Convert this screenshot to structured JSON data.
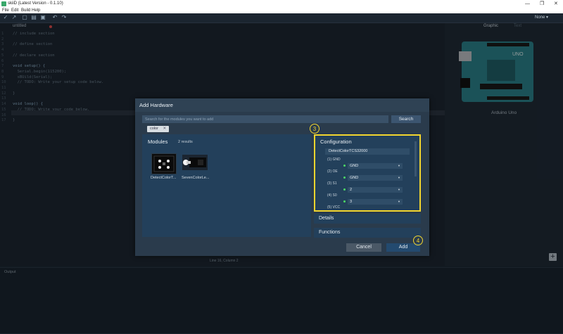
{
  "window": {
    "title": "skiiD (Latest Version - 0.1.10)",
    "minimize": "—",
    "maximize": "❐",
    "close": "✕"
  },
  "menu": {
    "file": "File",
    "edit": "Edit",
    "build": "Build",
    "help": "Help"
  },
  "toolbar": {
    "board_selector": "None ▾"
  },
  "editor": {
    "tab_name": "untitled",
    "lines": [
      {
        "n": "1",
        "text": "// include section"
      },
      {
        "n": "2",
        "text": ""
      },
      {
        "n": "3",
        "text": "// define section"
      },
      {
        "n": "4",
        "text": ""
      },
      {
        "n": "5",
        "text": "// declare section"
      },
      {
        "n": "6",
        "text": ""
      },
      {
        "n": "7",
        "text": "void setup() {"
      },
      {
        "n": "8",
        "text": "  Serial.begin(115200);"
      },
      {
        "n": "9",
        "text": "  sBUild(Serial);"
      },
      {
        "n": "10",
        "text": "  // TODO: Write your setup code below."
      },
      {
        "n": "11",
        "text": ""
      },
      {
        "n": "12",
        "text": "}"
      },
      {
        "n": "13",
        "text": ""
      },
      {
        "n": "14",
        "text": "void loop() {"
      },
      {
        "n": "15",
        "text": "  // TODO: Write your code below."
      },
      {
        "n": "16",
        "text": ""
      },
      {
        "n": "17",
        "text": "}"
      }
    ]
  },
  "right_panel": {
    "tab_graphic": "Graphic",
    "tab_text": "Text",
    "board_name": "Arduino Uno",
    "add_symbol": "+"
  },
  "status": {
    "text": "Line 16, Column 2"
  },
  "output": {
    "label": "Output"
  },
  "modal": {
    "title": "Add Hardware",
    "search_placeholder": "Search for the modules you want to add",
    "search_button": "Search",
    "filter_chip": "color",
    "chip_remove": "✕",
    "modules_title": "Modules",
    "modules_count": "2 results",
    "modules": [
      {
        "label": "DetectColorT..."
      },
      {
        "label": "SevenColorLe..."
      }
    ],
    "config": {
      "title": "Configuration",
      "module_name": "DetectColorTCS32000",
      "pins": [
        {
          "label": "(1) GND",
          "value": "GND"
        },
        {
          "label": "(2) OE",
          "value": "GND"
        },
        {
          "label": "(3) S1",
          "value": "2"
        },
        {
          "label": "(4) S0",
          "value": "3"
        },
        {
          "label": "(5) VCC",
          "value": ""
        }
      ]
    },
    "details": "Details",
    "functions": "Functions",
    "cancel": "Cancel",
    "add": "Add",
    "marker_3": "3",
    "marker_4": "4"
  }
}
